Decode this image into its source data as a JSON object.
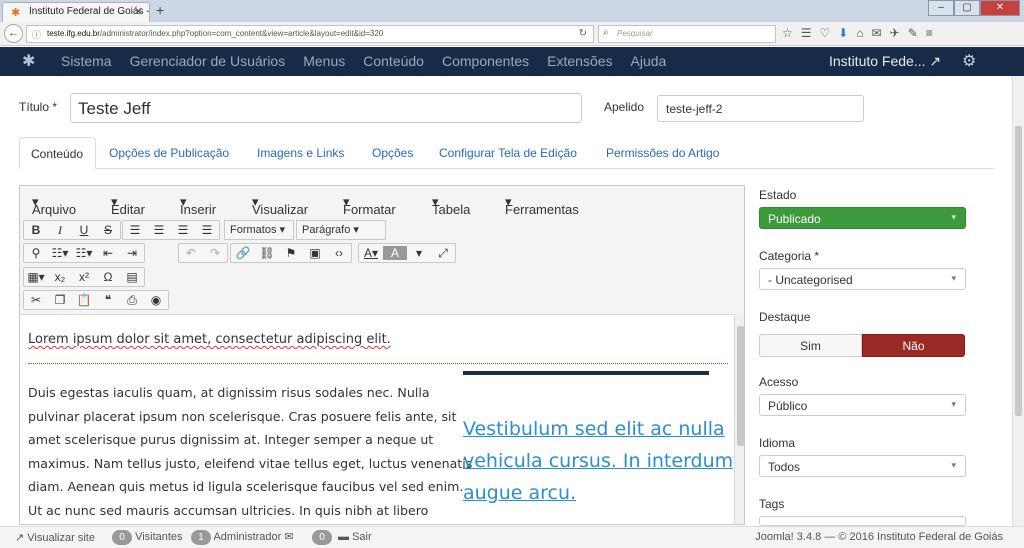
{
  "browser": {
    "tab_title": "Instituto Federal de Goiás -...",
    "url_host": "teste.ifg.edu.br",
    "url_path": "/administrator/index.php?option=com_content&view=article&layout=edit&id=320",
    "search_placeholder": "Pesquisar"
  },
  "admin_nav": {
    "items": [
      "Sistema",
      "Gerenciador de Usuários",
      "Menus",
      "Conteúdo",
      "Componentes",
      "Extensões",
      "Ajuda"
    ],
    "site_name": "Instituto Fede..."
  },
  "form": {
    "title_label": "Título *",
    "title_value": "Teste Jeff",
    "alias_label": "Apelido",
    "alias_value": "teste-jeff-2"
  },
  "tabs": [
    "Conteúdo",
    "Opções de Publicação",
    "Imagens e Links",
    "Opções",
    "Configurar Tela de Edição",
    "Permissões do Artigo"
  ],
  "editor": {
    "menus": [
      "Arquivo",
      "Editar",
      "Inserir",
      "Visualizar",
      "Formatar",
      "Tabela",
      "Ferramentas"
    ],
    "formats_label": "Formatos",
    "paragraph_label": "Parágrafo",
    "intro_line": "Lorem ipsum dolor sit amet, consectetur adipiscing elit.",
    "body_lines": [
      "Duis egestas iaculis quam, at dignissim risus sodales nec. Nulla",
      "pulvinar placerat ipsum non scelerisque. Cras posuere felis ante, sit",
      "amet scelerisque purus dignissim at. Integer semper a neque ut",
      "maximus. Nam tellus justo, eleifend vitae tellus eget, luctus venenatis",
      "diam. Aenean quis metus id ligula scelerisque faucibus vel sed enim.",
      "Ut ac nunc sed mauris accumsan ultricies. In quis nibh at libero"
    ],
    "pull_quote": [
      "Vestibulum sed elit ac nulla",
      "vehicula cursus. In interdum",
      "augue arcu."
    ]
  },
  "sidebar": {
    "status_label": "Estado",
    "status_value": "Publicado",
    "category_label": "Categoria *",
    "category_value": "- Uncategorised",
    "featured_label": "Destaque",
    "featured_yes": "Sim",
    "featured_no": "Não",
    "access_label": "Acesso",
    "access_value": "Público",
    "language_label": "Idioma",
    "language_value": "Todos",
    "tags_label": "Tags"
  },
  "footer": {
    "view_site": "Visualizar site",
    "visitors_count": "0",
    "visitors_label": "Visitantes",
    "admin_count": "1",
    "admin_label": "Administrador",
    "messages_count": "0",
    "logout": "Sair",
    "copyright": "Joomla! 3.4.8 — © 2016 Instituto Federal de Goiás"
  },
  "colors": {
    "nav_bg": "#172a47",
    "published_green": "#3d9a3c",
    "no_red": "#9c2a24",
    "link_blue": "#2a69b8",
    "quote_blue": "#2a8fd0"
  }
}
